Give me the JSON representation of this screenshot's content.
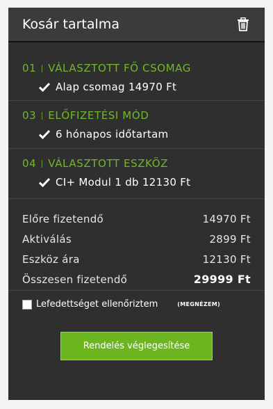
{
  "header": {
    "title": "Kosár tartalma",
    "trash_icon": "trash-icon"
  },
  "sections": [
    {
      "num": "01",
      "title": "VÁLASZTOTT FŐ CSOMAG",
      "value": "Alap csomag 14970 Ft"
    },
    {
      "num": "03",
      "title": "ELŐFIZETÉSI MÓD",
      "value": "6 hónapos időtartam"
    },
    {
      "num": "04",
      "title": "VÁLASZTOTT ESZKÖZ",
      "value": "CI+ Modul 1 db 12130 Ft"
    }
  ],
  "summary": [
    {
      "label": "Előre fizetendő",
      "value": "14970 Ft"
    },
    {
      "label": "Aktiválás",
      "value": "2899 Ft"
    },
    {
      "label": "Eszköz ára",
      "value": "12130 Ft"
    },
    {
      "label": "Összesen fizetendő",
      "value": "29999 Ft"
    }
  ],
  "coverage": {
    "label": "Lefedettséget ellenőriztem",
    "link": "(MEGNÉZEM)",
    "checked": false
  },
  "button": {
    "label": "Rendelés véglegesítése"
  },
  "colors": {
    "accent": "#72b82a",
    "button": "#6db51f",
    "panel": "#2f2f2f",
    "header": "#3b3b3b"
  }
}
